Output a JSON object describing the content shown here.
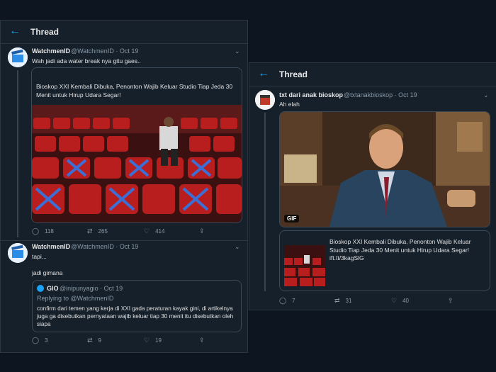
{
  "left": {
    "header": {
      "back": "←",
      "title": "Thread"
    },
    "tweet1": {
      "name": "WatchmenID",
      "meta": "@WatchmenID · Oct 19",
      "text": "Wah jadi ada water break nya gitu gaes..",
      "card_title": "Bioskop XXI Kembali Dibuka, Penonton Wajib Keluar Studio Tiap Jeda 30 Menit untuk Hirup Udara Segar!",
      "replies": "118",
      "retweets": "265",
      "likes": "414"
    },
    "tweet2": {
      "name": "WatchmenID",
      "meta": "@WatchmenID · Oct 19",
      "text1": "tapi...",
      "text2": "jadi gimana",
      "quote": {
        "name": "GIO",
        "meta": "@inipunyagio · Oct 19",
        "replying": "Replying to @WatchmenID",
        "text": "confirm dari temen yang kerja di XXI gada peraturan kayak gini, di artikelnya juga ga disebutkan pernyataan wajib keluar tiap 30 menit itu disebutkan oleh siapa"
      },
      "replies": "3",
      "retweets": "9",
      "likes": "19"
    }
  },
  "right": {
    "header": {
      "back": "←",
      "title": "Thread"
    },
    "tweet": {
      "name": "txt dari anak bioskop",
      "meta": "@txtanakbioskop · Oct 19",
      "text": "Ah elah",
      "gif_badge": "GIF",
      "card_text": "Bioskop XXI Kembali Dibuka, Penonton Wajib Keluar Studio Tiap Jeda 30 Menit untuk Hirup Udara Segar! ift.tt/3kagSlG",
      "replies": "7",
      "retweets": "31",
      "likes": "40"
    }
  },
  "icons": {
    "reply": "reply-icon",
    "retweet": "retweet-icon",
    "like": "heart-icon",
    "share": "share-icon",
    "chevron": "chevron-down-icon"
  },
  "colors": {
    "accent": "#1da1f2",
    "bg": "#15202b"
  }
}
